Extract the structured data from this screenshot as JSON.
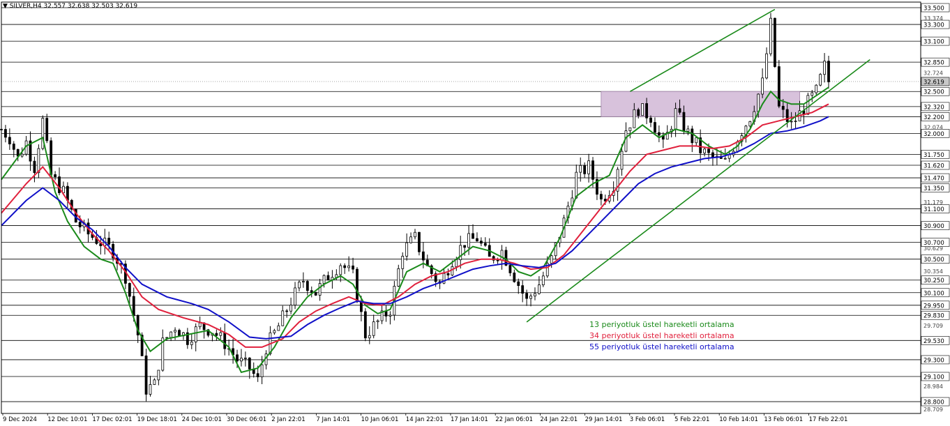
{
  "header": {
    "symbol": "SILVER,H4",
    "ohlc": "32.557 32.638 32.503 32.619"
  },
  "legend": [
    {
      "label": "13 periyotluk üstel hareketli ortalama",
      "color": "#1a8a1a"
    },
    {
      "label": "34 periyotluk üstel hareketli ortalama",
      "color": "#e0203c"
    },
    {
      "label": "55 periyotluk üstel hareketli ortalama",
      "color": "#1010c8"
    }
  ],
  "colors": {
    "candles": "#000000",
    "channel": "#1a8a1a",
    "zone": "#d8c2dc",
    "current_price_bg": "#c8c8c8"
  },
  "chart_data": {
    "type": "line",
    "title": "SILVER,H4",
    "ylim": [
      28.709,
      33.5
    ],
    "y_ticks_boxed": [
      "33.500",
      "33.300",
      "33.100",
      "32.850",
      "32.619",
      "32.500",
      "32.320",
      "32.200",
      "32.000",
      "31.750",
      "31.620",
      "31.470",
      "31.350",
      "31.100",
      "30.900",
      "30.700",
      "30.500",
      "30.250",
      "30.100",
      "29.950",
      "29.830",
      "29.530",
      "29.300",
      "29.100",
      "28.800"
    ],
    "y_ticks_plain": [
      "33.374",
      "32.724",
      "32.074",
      "31.179",
      "30.629",
      "30.354",
      "29.709",
      "28.984",
      "28.709"
    ],
    "horizontal_levels": [
      33.5,
      33.3,
      33.1,
      32.85,
      32.5,
      32.32,
      32.2,
      32.0,
      31.75,
      31.62,
      31.47,
      31.35,
      31.1,
      30.9,
      30.7,
      30.5,
      30.25,
      30.1,
      29.95,
      29.83,
      29.53,
      29.3,
      29.1,
      28.8
    ],
    "current_price": 32.619,
    "x_labels": [
      "9 Dec 2024",
      "12 Dec 10:01",
      "17 Dec 02:01",
      "19 Dec 18:01",
      "24 Dec 10:01",
      "30 Dec 06:01",
      "2 Jan 22:01",
      "7 Jan 14:01",
      "10 Jan 06:01",
      "14 Jan 22:01",
      "17 Jan 14:01",
      "22 Jan 06:01",
      "24 Jan 22:01",
      "29 Jan 14:01",
      "3 Feb 06:01",
      "5 Feb 22:01",
      "10 Feb 14:01",
      "13 Feb 06:01",
      "17 Feb 22:01"
    ],
    "price_path": [
      [
        0,
        32.05
      ],
      [
        2,
        31.95
      ],
      [
        4,
        31.7
      ],
      [
        6,
        31.9
      ],
      [
        8,
        31.6
      ],
      [
        10,
        32.15
      ],
      [
        12,
        31.5
      ],
      [
        15,
        31.3
      ],
      [
        18,
        30.95
      ],
      [
        21,
        30.8
      ],
      [
        24,
        30.7
      ],
      [
        27,
        30.6
      ],
      [
        30,
        30.3
      ],
      [
        33,
        29.6
      ],
      [
        35,
        28.95
      ],
      [
        37,
        29.0
      ],
      [
        39,
        29.5
      ],
      [
        42,
        29.7
      ],
      [
        45,
        29.55
      ],
      [
        48,
        29.7
      ],
      [
        51,
        29.65
      ],
      [
        54,
        29.5
      ],
      [
        57,
        29.3
      ],
      [
        60,
        29.2
      ],
      [
        62,
        29.05
      ],
      [
        64,
        29.45
      ],
      [
        67,
        29.7
      ],
      [
        70,
        30.0
      ],
      [
        73,
        30.25
      ],
      [
        76,
        30.1
      ],
      [
        79,
        30.3
      ],
      [
        82,
        30.45
      ],
      [
        85,
        30.3
      ],
      [
        88,
        29.6
      ],
      [
        91,
        29.75
      ],
      [
        94,
        29.9
      ],
      [
        97,
        30.6
      ],
      [
        100,
        30.75
      ],
      [
        103,
        30.4
      ],
      [
        106,
        30.2
      ],
      [
        109,
        30.5
      ],
      [
        112,
        30.7
      ],
      [
        115,
        30.75
      ],
      [
        118,
        30.5
      ],
      [
        121,
        30.6
      ],
      [
        124,
        30.3
      ],
      [
        127,
        30.0
      ],
      [
        130,
        30.2
      ],
      [
        133,
        30.5
      ],
      [
        136,
        30.95
      ],
      [
        139,
        31.5
      ],
      [
        142,
        31.6
      ],
      [
        145,
        31.2
      ],
      [
        148,
        31.4
      ],
      [
        151,
        32.05
      ],
      [
        154,
        32.3
      ],
      [
        157,
        32.2
      ],
      [
        160,
        31.85
      ],
      [
        163,
        32.25
      ],
      [
        166,
        32.0
      ],
      [
        169,
        31.8
      ],
      [
        172,
        31.7
      ],
      [
        175,
        31.65
      ],
      [
        178,
        31.95
      ],
      [
        181,
        32.2
      ],
      [
        184,
        32.6
      ],
      [
        186,
        33.3
      ],
      [
        188,
        32.3
      ],
      [
        191,
        32.1
      ],
      [
        194,
        32.3
      ],
      [
        197,
        32.5
      ],
      [
        199,
        32.8
      ],
      [
        200,
        32.62
      ]
    ],
    "series": [
      {
        "name": "13 periyotluk üstel hareketli ortalama",
        "points": [
          [
            0,
            31.45
          ],
          [
            6,
            31.85
          ],
          [
            10,
            31.95
          ],
          [
            13,
            31.3
          ],
          [
            16,
            30.95
          ],
          [
            20,
            30.65
          ],
          [
            24,
            30.5
          ],
          [
            27,
            30.45
          ],
          [
            30,
            30.1
          ],
          [
            33,
            29.65
          ],
          [
            36,
            29.4
          ],
          [
            40,
            29.55
          ],
          [
            45,
            29.6
          ],
          [
            50,
            29.65
          ],
          [
            55,
            29.45
          ],
          [
            58,
            29.15
          ],
          [
            62,
            29.2
          ],
          [
            66,
            29.45
          ],
          [
            70,
            29.8
          ],
          [
            74,
            30.05
          ],
          [
            78,
            30.2
          ],
          [
            82,
            30.3
          ],
          [
            85,
            30.2
          ],
          [
            88,
            29.95
          ],
          [
            91,
            29.85
          ],
          [
            94,
            29.9
          ],
          [
            98,
            30.35
          ],
          [
            102,
            30.45
          ],
          [
            106,
            30.35
          ],
          [
            110,
            30.5
          ],
          [
            114,
            30.65
          ],
          [
            118,
            30.6
          ],
          [
            122,
            30.5
          ],
          [
            125,
            30.35
          ],
          [
            128,
            30.3
          ],
          [
            131,
            30.4
          ],
          [
            135,
            30.75
          ],
          [
            139,
            31.25
          ],
          [
            143,
            31.4
          ],
          [
            147,
            31.5
          ],
          [
            151,
            31.95
          ],
          [
            155,
            32.1
          ],
          [
            159,
            31.95
          ],
          [
            163,
            32.05
          ],
          [
            167,
            32.0
          ],
          [
            171,
            31.85
          ],
          [
            175,
            31.75
          ],
          [
            178,
            31.85
          ],
          [
            181,
            32.05
          ],
          [
            184,
            32.35
          ],
          [
            186,
            32.5
          ],
          [
            188,
            32.4
          ],
          [
            191,
            32.35
          ],
          [
            194,
            32.35
          ],
          [
            197,
            32.45
          ],
          [
            200,
            32.55
          ]
        ]
      },
      {
        "name": "34 periyotluk üstel hareketli ortalama",
        "points": [
          [
            0,
            31.05
          ],
          [
            6,
            31.4
          ],
          [
            10,
            31.6
          ],
          [
            14,
            31.35
          ],
          [
            18,
            31.05
          ],
          [
            22,
            30.8
          ],
          [
            26,
            30.6
          ],
          [
            30,
            30.35
          ],
          [
            34,
            30.05
          ],
          [
            38,
            29.9
          ],
          [
            44,
            29.8
          ],
          [
            50,
            29.72
          ],
          [
            55,
            29.6
          ],
          [
            59,
            29.45
          ],
          [
            63,
            29.45
          ],
          [
            68,
            29.55
          ],
          [
            72,
            29.75
          ],
          [
            76,
            29.88
          ],
          [
            80,
            29.97
          ],
          [
            84,
            30.05
          ],
          [
            88,
            29.97
          ],
          [
            92,
            29.95
          ],
          [
            96,
            30.05
          ],
          [
            100,
            30.2
          ],
          [
            104,
            30.3
          ],
          [
            108,
            30.35
          ],
          [
            112,
            30.45
          ],
          [
            116,
            30.5
          ],
          [
            120,
            30.5
          ],
          [
            124,
            30.45
          ],
          [
            128,
            30.38
          ],
          [
            132,
            30.4
          ],
          [
            136,
            30.55
          ],
          [
            140,
            30.8
          ],
          [
            144,
            31.05
          ],
          [
            148,
            31.3
          ],
          [
            152,
            31.55
          ],
          [
            156,
            31.75
          ],
          [
            160,
            31.8
          ],
          [
            164,
            31.85
          ],
          [
            168,
            31.85
          ],
          [
            172,
            31.82
          ],
          [
            176,
            31.85
          ],
          [
            180,
            31.95
          ],
          [
            184,
            32.1
          ],
          [
            188,
            32.15
          ],
          [
            192,
            32.2
          ],
          [
            196,
            32.25
          ],
          [
            200,
            32.35
          ]
        ]
      },
      {
        "name": "55 periyotluk üstel hareketli ortalama",
        "points": [
          [
            0,
            30.9
          ],
          [
            6,
            31.2
          ],
          [
            10,
            31.35
          ],
          [
            14,
            31.2
          ],
          [
            18,
            31.0
          ],
          [
            22,
            30.85
          ],
          [
            26,
            30.65
          ],
          [
            30,
            30.4
          ],
          [
            34,
            30.2
          ],
          [
            40,
            30.05
          ],
          [
            46,
            29.97
          ],
          [
            50,
            29.9
          ],
          [
            55,
            29.75
          ],
          [
            60,
            29.57
          ],
          [
            64,
            29.55
          ],
          [
            70,
            29.58
          ],
          [
            74,
            29.72
          ],
          [
            78,
            29.83
          ],
          [
            82,
            29.92
          ],
          [
            86,
            30.0
          ],
          [
            90,
            29.97
          ],
          [
            94,
            29.97
          ],
          [
            98,
            30.05
          ],
          [
            102,
            30.15
          ],
          [
            106,
            30.22
          ],
          [
            110,
            30.3
          ],
          [
            114,
            30.38
          ],
          [
            118,
            30.42
          ],
          [
            122,
            30.45
          ],
          [
            126,
            30.42
          ],
          [
            130,
            30.4
          ],
          [
            134,
            30.45
          ],
          [
            138,
            30.6
          ],
          [
            142,
            30.8
          ],
          [
            146,
            31.0
          ],
          [
            150,
            31.2
          ],
          [
            154,
            31.4
          ],
          [
            158,
            31.52
          ],
          [
            162,
            31.6
          ],
          [
            166,
            31.65
          ],
          [
            170,
            31.7
          ],
          [
            174,
            31.72
          ],
          [
            178,
            31.78
          ],
          [
            182,
            31.88
          ],
          [
            186,
            32.0
          ],
          [
            190,
            32.03
          ],
          [
            194,
            32.08
          ],
          [
            198,
            32.15
          ],
          [
            200,
            32.2
          ]
        ]
      }
    ],
    "channel_lines": [
      {
        "from": [
          127,
          29.75
        ],
        "to": [
          210,
          32.88
        ]
      },
      {
        "from": [
          152,
          32.5
        ],
        "to": [
          187,
          33.48
        ]
      }
    ],
    "zone": {
      "x0": 145,
      "x1": 193,
      "y_low": 32.2,
      "y_high": 32.5
    }
  }
}
